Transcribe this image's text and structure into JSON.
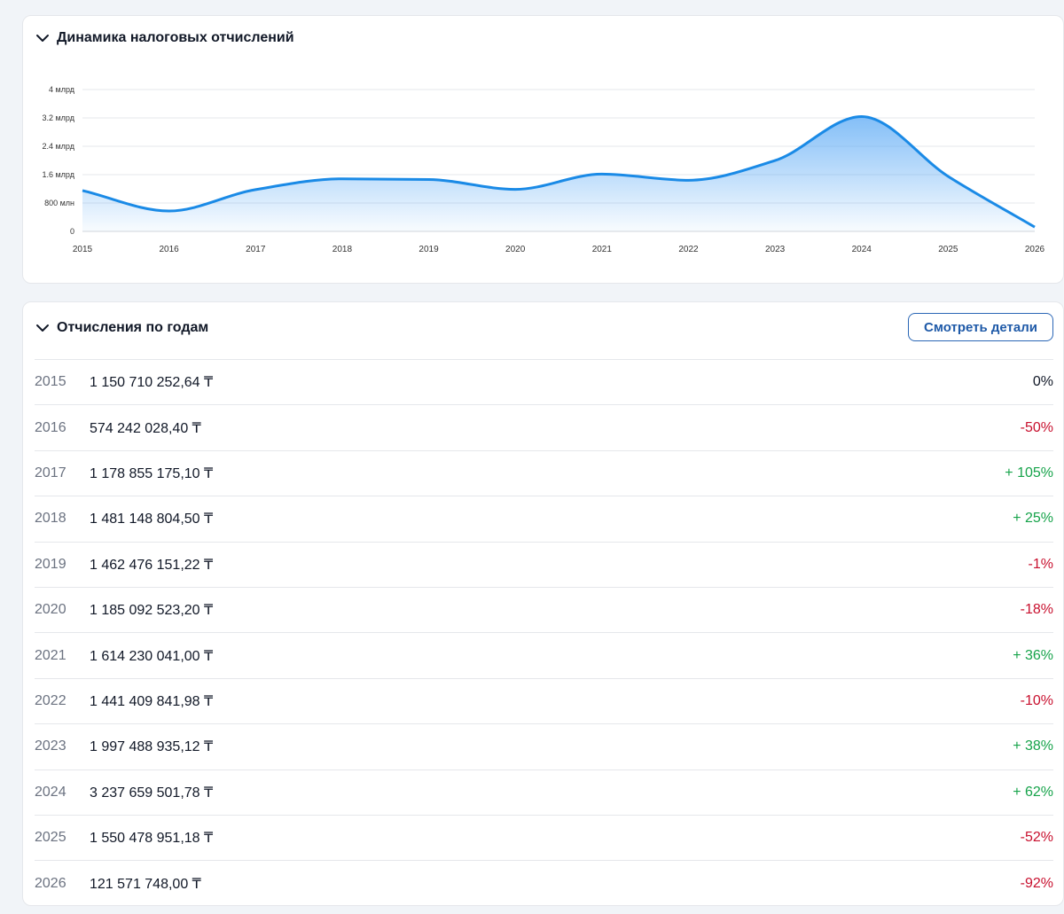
{
  "chart_card": {
    "title": "Динамика налоговых отчислений",
    "chevron_icon": "chevron-down-icon"
  },
  "chart_data": {
    "type": "area",
    "title": "Динамика налоговых отчислений",
    "x": [
      "2015",
      "2016",
      "2017",
      "2018",
      "2019",
      "2020",
      "2021",
      "2022",
      "2023",
      "2024",
      "2025",
      "2026"
    ],
    "values": [
      1150710252.64,
      574242028.4,
      1178855175.1,
      1481148804.5,
      1462476151.22,
      1185092523.2,
      1614230041.0,
      1441409841.98,
      1997488935.12,
      3237659501.78,
      1550478951.18,
      121571748.0
    ],
    "ylim": [
      0,
      4000000000
    ],
    "y_ticks": [
      {
        "value": 0,
        "label": "0"
      },
      {
        "value": 800000000,
        "label": "800 млн"
      },
      {
        "value": 1600000000,
        "label": "1.6 млрд"
      },
      {
        "value": 2400000000,
        "label": "2.4 млрд"
      },
      {
        "value": 3200000000,
        "label": "3.2 млрд"
      },
      {
        "value": 4000000000,
        "label": "4 млрд"
      }
    ],
    "grid": true,
    "line_color": "#1a8ae6",
    "fill_color": "#5aa9f5"
  },
  "table_card": {
    "title": "Отчисления по годам",
    "chevron_icon": "chevron-down-icon",
    "details_button": "Смотреть детали",
    "rows": [
      {
        "year": "2015",
        "amount": "1 150 710 252,64 ₸",
        "change": "0%",
        "trend": "neutral"
      },
      {
        "year": "2016",
        "amount": "574 242 028,40 ₸",
        "change": "-50%",
        "trend": "neg"
      },
      {
        "year": "2017",
        "amount": "1 178 855 175,10 ₸",
        "change": "+ 105%",
        "trend": "pos"
      },
      {
        "year": "2018",
        "amount": "1 481 148 804,50 ₸",
        "change": "+ 25%",
        "trend": "pos"
      },
      {
        "year": "2019",
        "amount": "1 462 476 151,22 ₸",
        "change": "-1%",
        "trend": "neg"
      },
      {
        "year": "2020",
        "amount": "1 185 092 523,20 ₸",
        "change": "-18%",
        "trend": "neg"
      },
      {
        "year": "2021",
        "amount": "1 614 230 041,00 ₸",
        "change": "+ 36%",
        "trend": "pos"
      },
      {
        "year": "2022",
        "amount": "1 441 409 841,98 ₸",
        "change": "-10%",
        "trend": "neg"
      },
      {
        "year": "2023",
        "amount": "1 997 488 935,12 ₸",
        "change": "+ 38%",
        "trend": "pos"
      },
      {
        "year": "2024",
        "amount": "3 237 659 501,78 ₸",
        "change": "+ 62%",
        "trend": "pos"
      },
      {
        "year": "2025",
        "amount": "1 550 478 951,18 ₸",
        "change": "-52%",
        "trend": "neg"
      },
      {
        "year": "2026",
        "amount": "121 571 748,00 ₸",
        "change": "-92%",
        "trend": "neg"
      }
    ]
  },
  "colors": {
    "positive": "#16a34a",
    "negative": "#c8102e",
    "accent": "#2b67b6"
  }
}
